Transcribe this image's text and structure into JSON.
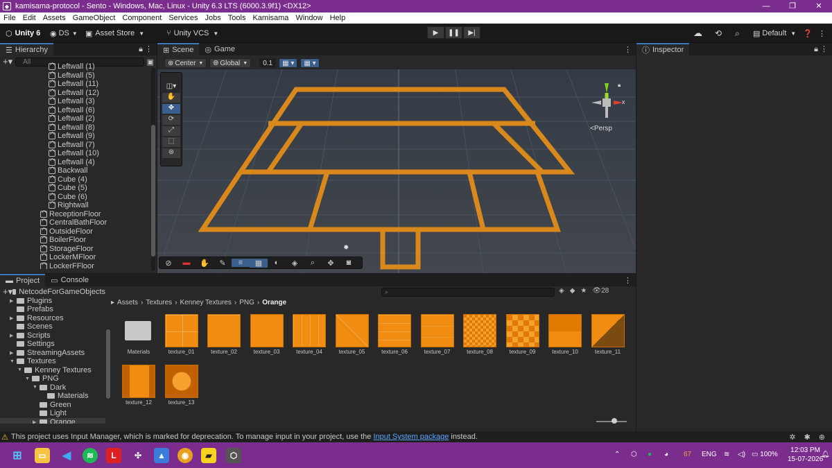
{
  "window": {
    "title": "kamisama-protocol - Sento - Windows, Mac, Linux - Unity 6.3 LTS (6000.3.9f1) <DX12>",
    "minimize": "—",
    "maximize": "❐",
    "close": "✕"
  },
  "menu": [
    "File",
    "Edit",
    "Assets",
    "GameObject",
    "Component",
    "Services",
    "Jobs",
    "Tools",
    "Kamisama",
    "Window",
    "Help"
  ],
  "toolbar": {
    "unity": "Unity 6",
    "account": "DS",
    "asset_store": "Asset Store",
    "vcs": "Unity VCS",
    "layout": "Default"
  },
  "hierarchy": {
    "tab": "Hierarchy",
    "search_placeholder": "All",
    "items": [
      {
        "label": "Leftwall (1)",
        "indent": 2
      },
      {
        "label": "Leftwall (5)",
        "indent": 2
      },
      {
        "label": "Leftwall (11)",
        "indent": 2
      },
      {
        "label": "Leftwall (12)",
        "indent": 2
      },
      {
        "label": "Leftwall (3)",
        "indent": 2
      },
      {
        "label": "Leftwall (6)",
        "indent": 2
      },
      {
        "label": "Leftwall (2)",
        "indent": 2
      },
      {
        "label": "Leftwall (8)",
        "indent": 2
      },
      {
        "label": "Leftwall (9)",
        "indent": 2
      },
      {
        "label": "Leftwall (7)",
        "indent": 2
      },
      {
        "label": "Leftwall (10)",
        "indent": 2
      },
      {
        "label": "Leftwall (4)",
        "indent": 2
      },
      {
        "label": "Backwall",
        "indent": 2
      },
      {
        "label": "Cube (4)",
        "indent": 2
      },
      {
        "label": "Cube (5)",
        "indent": 2
      },
      {
        "label": "Cube (6)",
        "indent": 2
      },
      {
        "label": "Rightwall",
        "indent": 2
      },
      {
        "label": "ReceptionFloor",
        "indent": 1
      },
      {
        "label": "CentralBathFloor",
        "indent": 1
      },
      {
        "label": "OutsideFloor",
        "indent": 1
      },
      {
        "label": "BoilerFloor",
        "indent": 1
      },
      {
        "label": "StorageFloor",
        "indent": 1
      },
      {
        "label": "LockerMFloor",
        "indent": 1
      },
      {
        "label": "LockerFFloor",
        "indent": 1
      }
    ]
  },
  "scene": {
    "tab_scene": "Scene",
    "tab_game": "Game",
    "pivot": "Center",
    "space": "Global",
    "snap": "0.1",
    "persp": "<Persp",
    "gizmo_axis": "x"
  },
  "inspector": {
    "tab": "Inspector"
  },
  "project": {
    "tab_project": "Project",
    "tab_console": "Console",
    "item_count": "28",
    "tree": [
      {
        "label": "NetcodeForGameObjects",
        "indent": 1,
        "arrow": ""
      },
      {
        "label": "Plugins",
        "indent": 1,
        "arrow": "▶"
      },
      {
        "label": "Prefabs",
        "indent": 1,
        "arrow": ""
      },
      {
        "label": "Resources",
        "indent": 1,
        "arrow": "▶"
      },
      {
        "label": "Scenes",
        "indent": 1,
        "arrow": ""
      },
      {
        "label": "Scripts",
        "indent": 1,
        "arrow": "▶"
      },
      {
        "label": "Settings",
        "indent": 1,
        "arrow": ""
      },
      {
        "label": "StreamingAssets",
        "indent": 1,
        "arrow": "▶"
      },
      {
        "label": "Textures",
        "indent": 1,
        "arrow": "▼"
      },
      {
        "label": "Kenney Textures",
        "indent": 2,
        "arrow": "▼"
      },
      {
        "label": "PNG",
        "indent": 3,
        "arrow": "▼"
      },
      {
        "label": "Dark",
        "indent": 4,
        "arrow": "▼"
      },
      {
        "label": "Materials",
        "indent": 5,
        "arrow": ""
      },
      {
        "label": "Green",
        "indent": 4,
        "arrow": ""
      },
      {
        "label": "Light",
        "indent": 4,
        "arrow": ""
      },
      {
        "label": "Orange",
        "indent": 4,
        "arrow": "▶"
      }
    ],
    "breadcrumb": [
      "Assets",
      "Textures",
      "Kenney Textures",
      "PNG",
      "Orange"
    ],
    "assets": [
      "Materials",
      "texture_01",
      "texture_02",
      "texture_03",
      "texture_04",
      "texture_05",
      "texture_06",
      "texture_07",
      "texture_08",
      "texture_09",
      "texture_10",
      "texture_11",
      "texture_12",
      "texture_13"
    ]
  },
  "status": {
    "prefix": "This project uses Input Manager, which is marked for deprecation. To manage input in your project, use the ",
    "link": "Input System package",
    "suffix": " instead."
  },
  "taskbar": {
    "tray_badge": "67",
    "lang": "ENG",
    "battery": "100%",
    "time": "12:03 PM",
    "date": "15-07-2026"
  },
  "colors": {
    "accent": "#7b2d8e",
    "wall": "#e0901e",
    "texture": "#f08c0f"
  }
}
